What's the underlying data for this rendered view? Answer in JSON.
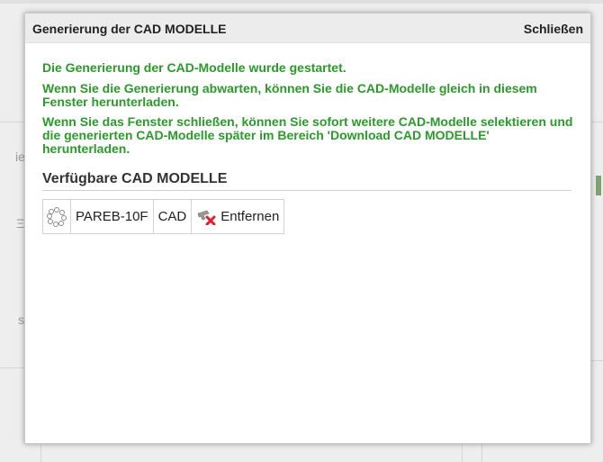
{
  "modal": {
    "title": "Generierung der CAD MODELLE",
    "close_label": "Schließen"
  },
  "messages": [
    "Die Generierung der CAD-Modelle wurde gestartet.",
    "Wenn Sie die Generierung abwarten, können Sie die CAD-Modelle gleich in diesem Fenster herunterladen.",
    "Wenn Sie das Fenster schließen, können Sie sofort weitere CAD-Modelle selektieren und die generierten CAD-Modelle später im Bereich 'Download CAD MODELLE' herunterladen."
  ],
  "models_section": {
    "title": "Verfügbare CAD MODELLE",
    "rows": [
      {
        "status_icon": "loading-spinner-icon",
        "name": "PAREB-10F",
        "type": "CAD",
        "action_icon": "remove-icon",
        "action_label": "Entfernen"
      }
    ]
  },
  "background": {
    "fragments": [
      "ie",
      "Ξ",
      "s"
    ]
  },
  "colors": {
    "message_green": "#2a9a2a",
    "header_bg": "#ececec"
  }
}
